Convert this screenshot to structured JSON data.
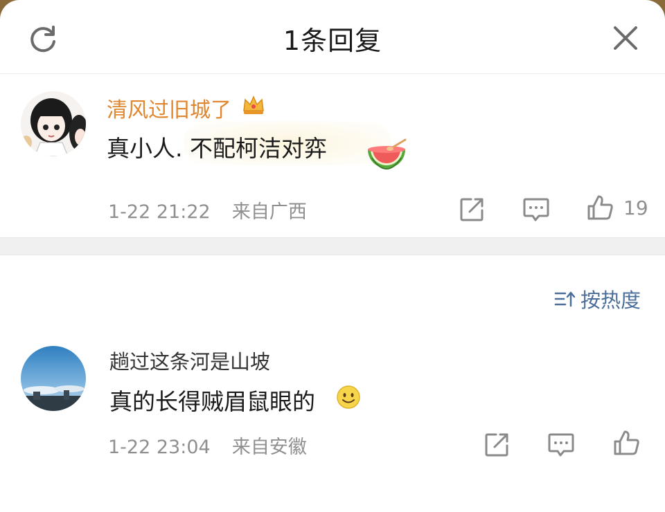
{
  "header": {
    "title": "1条回复"
  },
  "original_comment": {
    "username": "清风过旧城了",
    "username_color": "#e0862f",
    "badge": "crown-badge-icon",
    "content": "真小人. 不配柯洁对弈",
    "sticker": "watermelon-sticker-icon",
    "time": "1-22 21:22",
    "location": "来自广西",
    "like_count": "19"
  },
  "sort": {
    "label": "按热度",
    "color": "#4a6d99"
  },
  "reply": {
    "username": "趟过这条河是山坡",
    "username_color": "#333333",
    "content": "真的长得贼眉鼠眼的",
    "emoji": "smile-emoji-icon",
    "time": "1-22 23:04",
    "location": "来自安徽"
  },
  "icons": [
    "refresh-icon",
    "close-icon",
    "share-icon",
    "comment-icon",
    "like-icon",
    "sort-icon"
  ]
}
